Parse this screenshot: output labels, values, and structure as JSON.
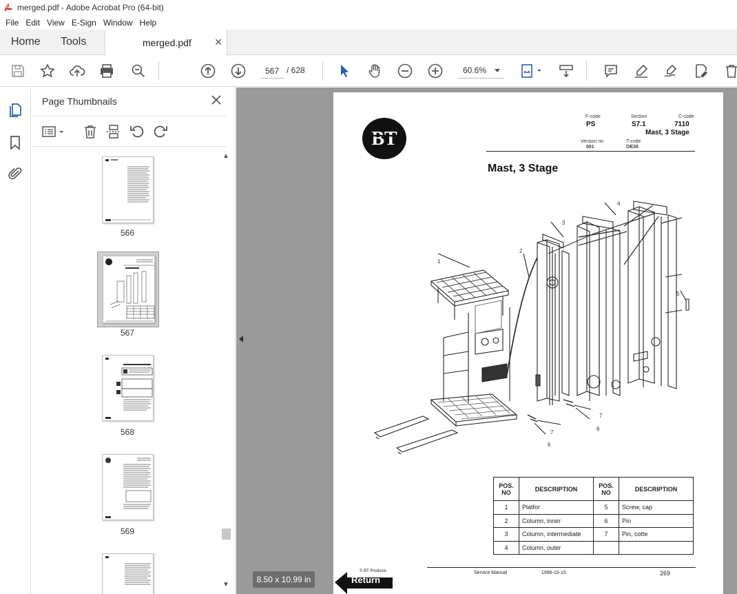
{
  "window": {
    "title": "merged.pdf - Adobe Acrobat Pro (64-bit)"
  },
  "menubar": {
    "items": [
      "File",
      "Edit",
      "View",
      "E-Sign",
      "Window",
      "Help"
    ]
  },
  "tabs": {
    "home": "Home",
    "tools": "Tools",
    "document": "merged.pdf"
  },
  "toolbar": {
    "current_page": "567",
    "total_pages": "/ 628",
    "zoom": "60.6%"
  },
  "thumbnail_panel": {
    "title": "Page Thumbnails",
    "pages": [
      "566",
      "567",
      "568",
      "569"
    ],
    "selected_page": "567"
  },
  "status": {
    "page_size": "8.50 x 10.99 in"
  },
  "document_page": {
    "header": {
      "fcode_label": "F-code",
      "fcode_value": "PS",
      "section_label": "Section",
      "section_value": "S7.1",
      "ccode_label": "C-code",
      "ccode_value": "7110",
      "subtitle": "Mast, 3 Stage",
      "version_label": "Version no",
      "version_value": "001",
      "tcode_label": "T-code",
      "tcode_value": "OE35"
    },
    "logo_text": "BT",
    "title": "Mast, 3 Stage",
    "callouts": [
      "1",
      "2",
      "3",
      "4",
      "5",
      "6",
      "7",
      "7",
      "6"
    ],
    "table": {
      "headers": [
        "POS. NO",
        "DESCRIPTION",
        "POS. NO",
        "DESCRIPTION"
      ],
      "rows": [
        [
          "1",
          "Platfor",
          "5",
          "Screw, cap"
        ],
        [
          "2",
          "Column, inner",
          "6",
          "Pin"
        ],
        [
          "3",
          "Column, intermediate",
          "7",
          "Pin, cotte"
        ],
        [
          "4",
          "Column, outer",
          "",
          ""
        ]
      ]
    },
    "footer": {
      "copyright": "© BT Products",
      "manual": "Service Manual",
      "date": "1996-10-15",
      "page_number": "269",
      "return_label": "Return"
    }
  },
  "colors": {
    "accent": "#2b5fb0",
    "chrome_bg": "#f1f1f1",
    "doc_bg": "#9a9a9a"
  }
}
